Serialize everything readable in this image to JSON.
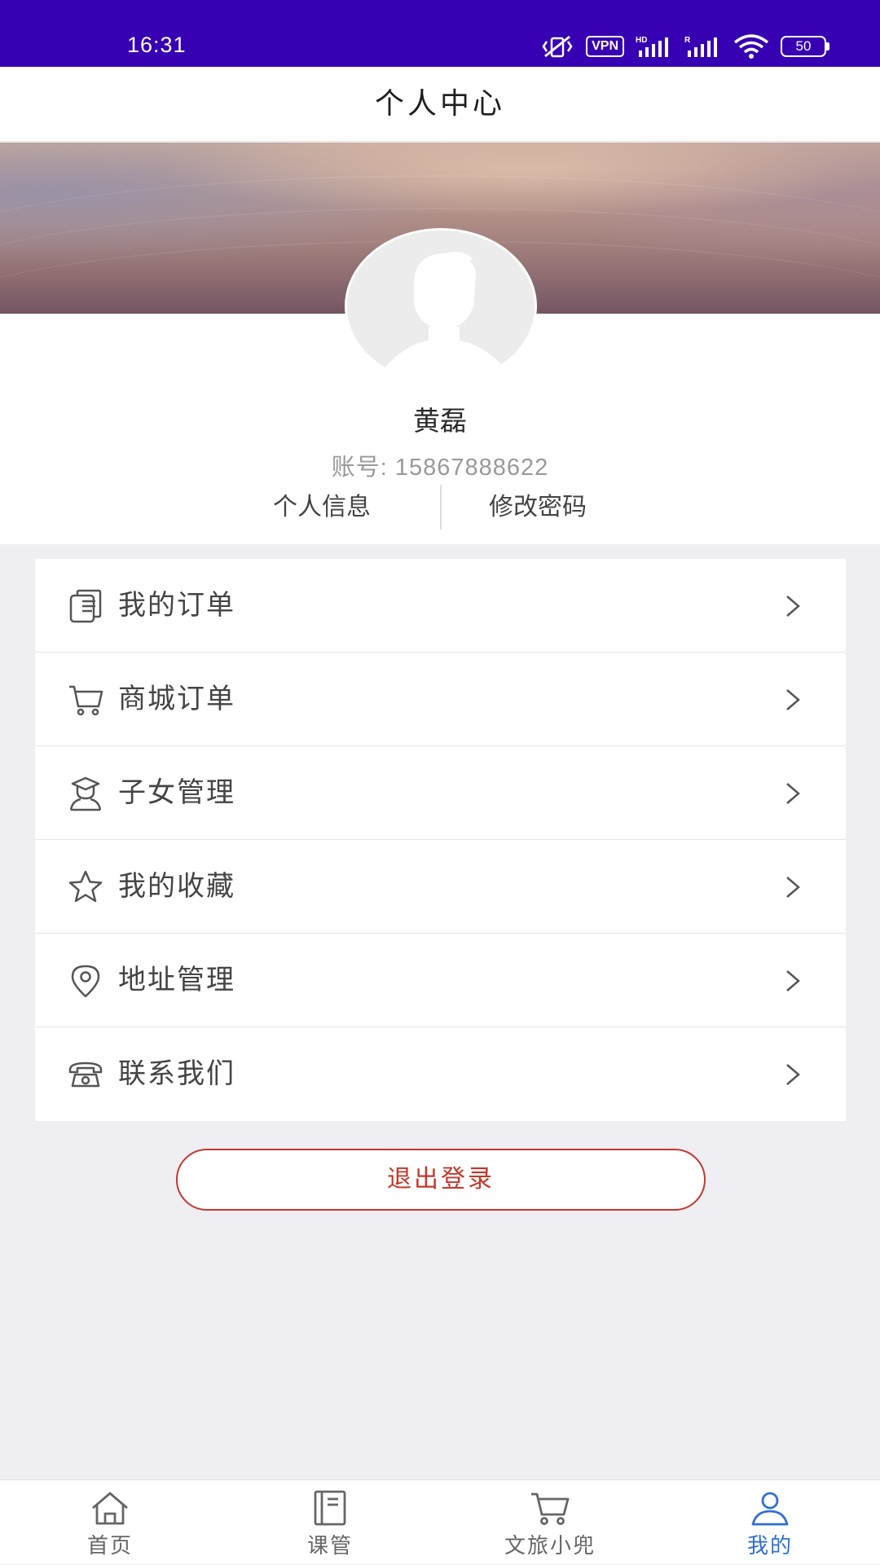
{
  "status_bar": {
    "time": "16:31",
    "vpn": "VPN",
    "battery": "50"
  },
  "header": {
    "title": "个人中心"
  },
  "profile": {
    "name": "黄磊",
    "account": "账号: 15867888622",
    "links": {
      "info": "个人信息",
      "password": "修改密码"
    }
  },
  "menu": {
    "items": [
      {
        "label": "我的订单",
        "icon": "document-icon"
      },
      {
        "label": "商城订单",
        "icon": "cart-icon"
      },
      {
        "label": "子女管理",
        "icon": "graduate-icon"
      },
      {
        "label": "我的收藏",
        "icon": "star-icon"
      },
      {
        "label": "地址管理",
        "icon": "location-icon"
      },
      {
        "label": "联系我们",
        "icon": "phone-icon"
      }
    ]
  },
  "logout_label": "退出登录",
  "tab_bar": {
    "items": [
      {
        "label": "首页",
        "icon": "home-icon"
      },
      {
        "label": "课管",
        "icon": "notebook-icon"
      },
      {
        "label": "文旅小兜",
        "icon": "cart-icon"
      },
      {
        "label": "我的",
        "icon": "user-icon"
      }
    ],
    "active_index": 3
  },
  "colors": {
    "status_bar": "#3700b3",
    "accent_red": "#c4372b",
    "accent_blue": "#2f6fd6",
    "background": "#efeef3"
  }
}
